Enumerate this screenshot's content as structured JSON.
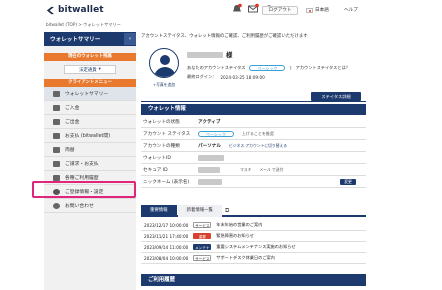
{
  "header": {
    "brand": "bitwallet",
    "logout_label": "ログアウト",
    "language": "日本語",
    "help_label": "ヘルプ",
    "icons": [
      "bell-icon",
      "envelope-icon",
      "user-icon"
    ]
  },
  "breadcrumb": "bitwallet (TOP) > ウォレットサマリー",
  "sidebar": {
    "title": "ウォレットサマリー",
    "current_wallet_label": "現在のウォレット残高",
    "currency_select": "法定通貨",
    "menu_label": "クライアントメニュー",
    "items": [
      {
        "label": "ウォレットサマリー",
        "icon": "wallet-icon"
      },
      {
        "label": "ご入金",
        "icon": "deposit-icon"
      },
      {
        "label": "ご出金",
        "icon": "withdraw-icon"
      },
      {
        "label": "お支払 (bitwallet間)",
        "icon": "transfer-icon"
      },
      {
        "label": "両替",
        "icon": "exchange-icon"
      },
      {
        "label": "ご請求・お支払",
        "icon": "invoice-icon"
      },
      {
        "label": "各種ご利用履歴",
        "icon": "history-icon"
      },
      {
        "label": "ご登録情報・設定",
        "icon": "gear-icon"
      },
      {
        "label": "お問い合わせ",
        "icon": "question-icon"
      }
    ]
  },
  "main": {
    "notice": "アカウントステイタス、ウォレット情報のご確認、ご利用履歴がご確認いただけます",
    "profile": {
      "honorific": "様",
      "status_label": "あなたのアカウントステイタス",
      "status_value": "ベーシック",
      "status_question": "アカウントステイタスとは？",
      "last_login_label": "最終ログイン：",
      "last_login_value": "2024-03-25 18:09:00",
      "avatar_link": "+写真を追加",
      "status_detail_button": "ステイタス詳細"
    },
    "wallet_info": {
      "title": "ウォレット情報",
      "rows": [
        {
          "key": "ウォレットの状態",
          "value": "アクティブ"
        },
        {
          "key": "アカウント ステイタス",
          "value": "ベーシック",
          "note": "上げることを推奨"
        },
        {
          "key": "アカウントの種類",
          "value": "パーソナル",
          "note": "ビジネス アカウントに切り替える"
        },
        {
          "key": "ウォレットID",
          "value": ""
        },
        {
          "key": "セキュア ID",
          "value": "",
          "extra": [
            "マスキ",
            "メール で送付"
          ]
        },
        {
          "key": "ニックネーム (表示名)",
          "value": "",
          "button": "変更"
        }
      ]
    },
    "tabs": [
      "重要情報",
      "新着情報一覧"
    ],
    "news": [
      {
        "date": "2023/12/17 10:00:00",
        "tag": "サービス",
        "text": "年末年始の営業のご案内",
        "tag_style": "plain"
      },
      {
        "date": "2023/11/21 17:40:00",
        "tag": "重要",
        "text": "緊急障害のお知らせ",
        "tag_style": "red"
      },
      {
        "date": "2023/09/14 11:00:00",
        "tag": "メンテナンス",
        "text": "重要システムメンテナンス実施のお知らせ",
        "tag_style": "dark"
      },
      {
        "date": "2023/08/04 10:00:00",
        "tag": "サービス",
        "text": "サポートデスク休業日のご案内",
        "tag_style": "plain"
      }
    ],
    "history_title": "ご利用履歴"
  },
  "colors": {
    "navy": "#1d3a6e",
    "orange": "#e8792e",
    "highlight": "#e0267a"
  }
}
